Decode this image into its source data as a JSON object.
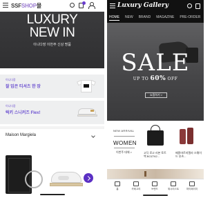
{
  "left_app": {
    "logo_brand": "SSF",
    "logo_shop": "SHOP",
    "logo_extra": "몰",
    "hero": {
      "line1": "LUXURY",
      "line2": "NEW IN",
      "subtitle": "이니다장 이번주 신상 명품"
    },
    "promo_cards": [
      {
        "small": "이니다장",
        "title": "잘 입은 티셔츠 한 장"
      },
      {
        "small": "이니다장",
        "title": "럭키 스니커즈 Flex!"
      }
    ],
    "brand_section": {
      "label": "Maison Margiela"
    }
  },
  "right_app": {
    "logo": "Luxury Gallery",
    "tabs": [
      "HOME",
      "NEW",
      "BRAND",
      "MAGAZINE",
      "PRE-ORDER"
    ],
    "active_tab": "HOME",
    "hero": {
      "title": "SALE",
      "sub_prefix": "UP TO ",
      "sub_value": "60%",
      "sub_suffix": " OFF",
      "button": "쇼핑하기 >"
    },
    "new_arrival": {
      "label": "NEW ARRIVAL",
      "title": "WOMEN",
      "link": "이번주 대체 >",
      "products": [
        {
          "desc": "고딕 로고 리본 토트백 BOZ762..."
        },
        {
          "desc": "메종마르지엘라 스웨이드 부츠..."
        }
      ]
    },
    "bottom_nav": [
      "홈",
      "카테고리",
      "브랜드",
      "위시리스트",
      "마이페이지"
    ]
  }
}
